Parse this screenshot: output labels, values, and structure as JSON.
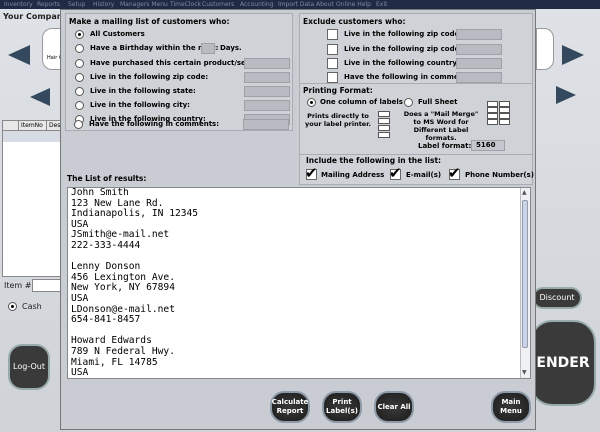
{
  "menubar": {
    "items": [
      "Inventory",
      "Reports",
      "Setup",
      "History",
      "Managers Menu",
      "TimeClock",
      "Customers",
      "Accounting",
      "Import Data",
      "About",
      "Online Help",
      "Exit"
    ]
  },
  "background": {
    "your_company": "Your Company",
    "item_no_header": "ItemNo",
    "desc_header": "Desc",
    "item_hash_label": "Item #",
    "cash_label": "Cash",
    "logout_label": "Log-Out",
    "discount_label": "Discount",
    "tender_label": "ENDER",
    "logo_text": "Hair C"
  },
  "mailing": {
    "title": "Make a mailing list of customers who:",
    "options": [
      "All Customers",
      "Have a Birthday within the next:",
      "Have purchased this certain product/service:",
      "Live in the following zip code:",
      "Live in the following state:",
      "Live in the following city:",
      "Live in the following country:",
      "Have the following in comments:"
    ],
    "days_label": "Days.",
    "selected_index": 0
  },
  "exclude": {
    "title": "Exclude customers who:",
    "options": [
      "Live in the following zip code:",
      "Live in the following zip code:",
      "Live in the following country:",
      "Have the following in comments:"
    ]
  },
  "printing": {
    "title": "Printing Format:",
    "one_column": "One column of labels",
    "full_sheet": "Full Sheet",
    "prints_directly": "Prints directly to your label printer.",
    "mail_merge": "Does a \"Mail Merge\" to MS Word for Different Label formats.",
    "label_format_label": "Label format:",
    "label_format_value": "5160"
  },
  "include": {
    "title": "Include the following in the list:",
    "mailing_address": "Mailing Address",
    "email": "E-mail(s)",
    "phone": "Phone Number(s)"
  },
  "results": {
    "title": "The List of results:",
    "text": "John Smith\n123 New Lane Rd.\nIndianapolis, IN 12345\nUSA\nJSmith@e-mail.net\n222-333-4444\n\nLenny Donson\n456 Lexington Ave.\nNew York, NY 67894\nUSA\nLDonson@e-mail.net\n654-841-8457\n\nHoward Edwards\n789 N Federal Hwy.\nMiami, FL 14785\nUSA\nHEdwards@e-mail.net"
  },
  "buttons": {
    "calculate": "Calculate Report",
    "print": "Print Label(s)",
    "clear": "Clear All",
    "main_menu": "Main Menu"
  },
  "colors": {
    "dialog_bg": "#c9ccd2",
    "menubar_bg": "#1f2a44",
    "button_bg": "#2a2a2a"
  }
}
